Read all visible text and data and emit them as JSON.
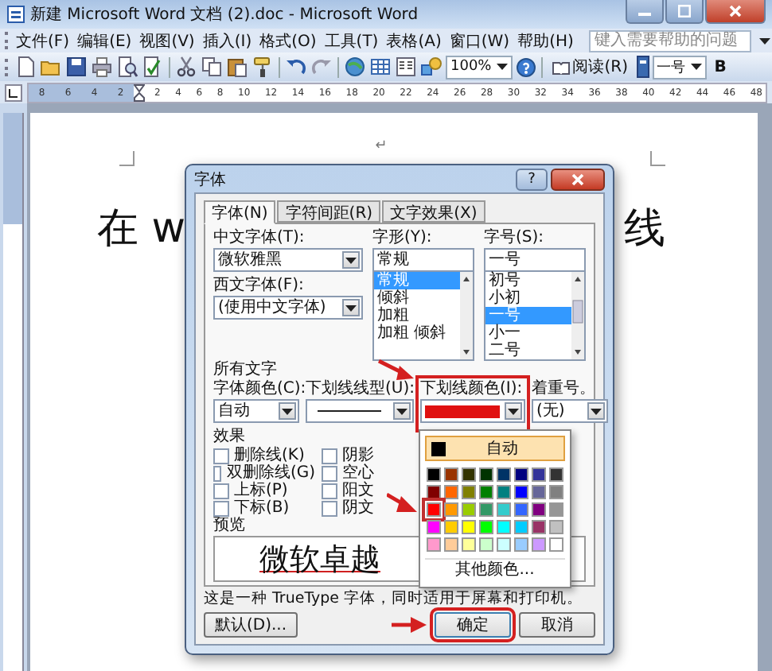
{
  "window": {
    "title": "新建 Microsoft Word 文档 (2).doc - Microsoft Word"
  },
  "menu": [
    {
      "label": "文件(F)"
    },
    {
      "label": "编辑(E)"
    },
    {
      "label": "视图(V)"
    },
    {
      "label": "插入(I)"
    },
    {
      "label": "格式(O)"
    },
    {
      "label": "工具(T)"
    },
    {
      "label": "表格(A)"
    },
    {
      "label": "窗口(W)"
    },
    {
      "label": "帮助(H)"
    }
  ],
  "help_box": {
    "placeholder": "键入需要帮助的问题"
  },
  "toolbar": {
    "zoom": "100%",
    "read_button": "阅读(R)",
    "font_size": "一号",
    "bold_button": "B"
  },
  "ruler": {
    "left_ticks": [
      "8",
      "6",
      "4",
      "2"
    ],
    "right_ticks": [
      "2",
      "4",
      "6",
      "8",
      "10",
      "12",
      "14",
      "16",
      "18",
      "20",
      "22",
      "24",
      "26",
      "28",
      "30",
      "32",
      "34",
      "36",
      "38",
      "40",
      "42",
      "44",
      "46",
      "48"
    ]
  },
  "document": {
    "paragraph_mark": "↵",
    "text_left": "在 w",
    "text_right": "线"
  },
  "dialog": {
    "title": "字体",
    "help_button": "?",
    "tabs": [
      {
        "label": "字体(N)",
        "selected": true
      },
      {
        "label": "字符间距(R)",
        "selected": false
      },
      {
        "label": "文字效果(X)",
        "selected": false
      }
    ],
    "chinese_font": {
      "label": "中文字体(T):",
      "value": "微软雅黑"
    },
    "western_font": {
      "label": "西文字体(F):",
      "value": "(使用中文字体)"
    },
    "font_style": {
      "label": "字形(Y):",
      "value": "常规",
      "options": [
        {
          "label": "常规",
          "selected": true
        },
        {
          "label": "倾斜",
          "selected": false
        },
        {
          "label": "加粗",
          "selected": false
        },
        {
          "label": "加粗 倾斜",
          "selected": false
        }
      ]
    },
    "font_size": {
      "label": "字号(S):",
      "value": "一号",
      "options": [
        {
          "label": "初号",
          "selected": false
        },
        {
          "label": "小初",
          "selected": false
        },
        {
          "label": "一号",
          "selected": true
        },
        {
          "label": "小一",
          "selected": false
        },
        {
          "label": "二号",
          "selected": false
        }
      ]
    },
    "all_text": {
      "heading": "所有文字",
      "fields": [
        {
          "kind": "text",
          "label": "字体颜色(C):",
          "value": "自动",
          "highlighted": false
        },
        {
          "kind": "line",
          "label": "下划线线型(U):",
          "highlighted": false
        },
        {
          "kind": "color",
          "label": "下划线颜色(I):",
          "color": "#e01010",
          "highlighted": true
        },
        {
          "kind": "text",
          "label": "着重号。",
          "value": "(无)",
          "highlighted": false
        }
      ]
    },
    "effects": {
      "heading": "效果",
      "left": [
        {
          "label": "删除线(K)",
          "checked": false
        },
        {
          "label": "双删除线(G)",
          "checked": false
        },
        {
          "label": "上标(P)",
          "checked": false
        },
        {
          "label": "下标(B)",
          "checked": false
        }
      ],
      "right": [
        {
          "label": "阴影",
          "checked": false
        },
        {
          "label": "空心",
          "checked": false
        },
        {
          "label": "阳文",
          "checked": false
        },
        {
          "label": "阴文",
          "checked": false
        }
      ]
    },
    "preview": {
      "heading": "预览",
      "sample": "微软卓越"
    },
    "note": "这是一种 TrueType 字体，同时适用于屏幕和打印机。",
    "buttons": [
      {
        "label": "默认(D)...",
        "highlighted": false
      },
      {
        "label": "确定",
        "highlighted": true
      },
      {
        "label": "取消",
        "highlighted": false
      }
    ]
  },
  "color_menu": {
    "auto_label": "自动",
    "more_label": "其他颜色...",
    "swatches": [
      {
        "color": "#000000",
        "selected": false
      },
      {
        "color": "#993300",
        "selected": false
      },
      {
        "color": "#333300",
        "selected": false
      },
      {
        "color": "#003300",
        "selected": false
      },
      {
        "color": "#003366",
        "selected": false
      },
      {
        "color": "#000080",
        "selected": false
      },
      {
        "color": "#333399",
        "selected": false
      },
      {
        "color": "#333333",
        "selected": false
      },
      {
        "color": "#800000",
        "selected": false
      },
      {
        "color": "#ff6600",
        "selected": false
      },
      {
        "color": "#808000",
        "selected": false
      },
      {
        "color": "#008000",
        "selected": false
      },
      {
        "color": "#008080",
        "selected": false
      },
      {
        "color": "#0000ff",
        "selected": false
      },
      {
        "color": "#666699",
        "selected": false
      },
      {
        "color": "#808080",
        "selected": false
      },
      {
        "color": "#ff0000",
        "selected": true
      },
      {
        "color": "#ff9900",
        "selected": false
      },
      {
        "color": "#99cc00",
        "selected": false
      },
      {
        "color": "#339966",
        "selected": false
      },
      {
        "color": "#33cccc",
        "selected": false
      },
      {
        "color": "#3366ff",
        "selected": false
      },
      {
        "color": "#800080",
        "selected": false
      },
      {
        "color": "#969696",
        "selected": false
      },
      {
        "color": "#ff00ff",
        "selected": false
      },
      {
        "color": "#ffcc00",
        "selected": false
      },
      {
        "color": "#ffff00",
        "selected": false
      },
      {
        "color": "#00ff00",
        "selected": false
      },
      {
        "color": "#00ffff",
        "selected": false
      },
      {
        "color": "#00ccff",
        "selected": false
      },
      {
        "color": "#993366",
        "selected": false
      },
      {
        "color": "#c0c0c0",
        "selected": false
      },
      {
        "color": "#ff99cc",
        "selected": false
      },
      {
        "color": "#ffcc99",
        "selected": false
      },
      {
        "color": "#ffff99",
        "selected": false
      },
      {
        "color": "#ccffcc",
        "selected": false
      },
      {
        "color": "#ccffff",
        "selected": false
      },
      {
        "color": "#99ccff",
        "selected": false
      },
      {
        "color": "#cc99ff",
        "selected": false
      },
      {
        "color": "#ffffff",
        "selected": false
      }
    ]
  }
}
